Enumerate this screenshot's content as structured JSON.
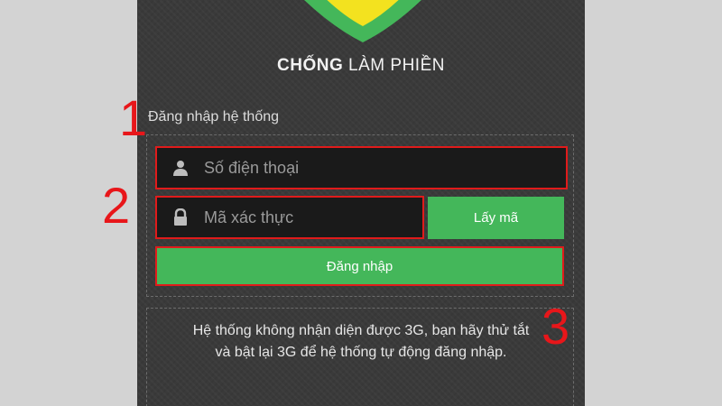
{
  "app": {
    "title_bold": "CHỐNG",
    "title_rest": "LÀM PHIỀN"
  },
  "login": {
    "heading": "Đăng nhập hệ thống",
    "phone_placeholder": "Số điện thoại",
    "code_placeholder": "Mã xác thực",
    "get_code_label": "Lấy mã",
    "submit_label": "Đăng nhập"
  },
  "info": {
    "line1": "Hệ thống không nhận diện được 3G, bạn hãy thử tắt",
    "line2": "và bật lại 3G để hệ thống tự động đăng nhập."
  },
  "annotations": {
    "step1": "1",
    "step2": "2",
    "step3": "3"
  },
  "icons": {
    "phone_field": "user-icon",
    "code_field": "lock-icon",
    "logo": "shield-logo"
  },
  "colors": {
    "accent_green": "#44b75a",
    "highlight_red": "#e01b1b",
    "shield_yellow": "#f3e21f",
    "background": "#3a3a3a"
  }
}
